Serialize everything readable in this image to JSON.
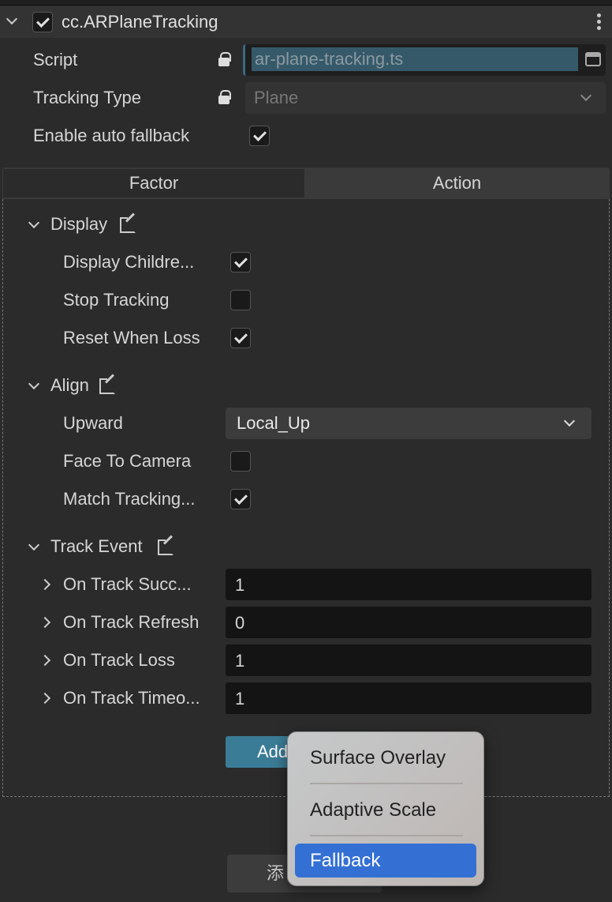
{
  "component": {
    "title": "cc.ARPlaneTracking",
    "enabled": true
  },
  "props": {
    "script": {
      "label": "Script",
      "value": "ar-plane-tracking.ts",
      "locked": true
    },
    "tracking_type": {
      "label": "Tracking Type",
      "value": "Plane",
      "locked": true
    },
    "auto_fallback": {
      "label": "Enable auto fallback",
      "checked": true
    }
  },
  "tabs": [
    {
      "label": "Factor",
      "active": false
    },
    {
      "label": "Action",
      "active": true
    }
  ],
  "display": {
    "title": "Display",
    "items": [
      {
        "label": "Display Childre...",
        "checked": true
      },
      {
        "label": "Stop Tracking",
        "checked": false
      },
      {
        "label": "Reset When Loss",
        "checked": true
      }
    ]
  },
  "align": {
    "title": "Align",
    "upward_label": "Upward",
    "upward_value": "Local_Up",
    "items": [
      {
        "label": "Face To Camera",
        "checked": false
      },
      {
        "label": "Match Tracking...",
        "checked": true
      }
    ]
  },
  "track_event": {
    "title": "Track Event",
    "items": [
      {
        "label": "On Track Succ...",
        "value": "1"
      },
      {
        "label": "On Track Refresh",
        "value": "0"
      },
      {
        "label": "On Track Loss",
        "value": "1"
      },
      {
        "label": "On Track Timeo...",
        "value": "1"
      }
    ]
  },
  "add_button": "Add",
  "bottom_button": "添",
  "menu": {
    "items": [
      "Surface Overlay",
      "Adaptive Scale",
      "Fallback"
    ],
    "highlighted": "Fallback"
  },
  "colors": {
    "accent": "#3a7c96",
    "highlight": "#3470d4"
  }
}
